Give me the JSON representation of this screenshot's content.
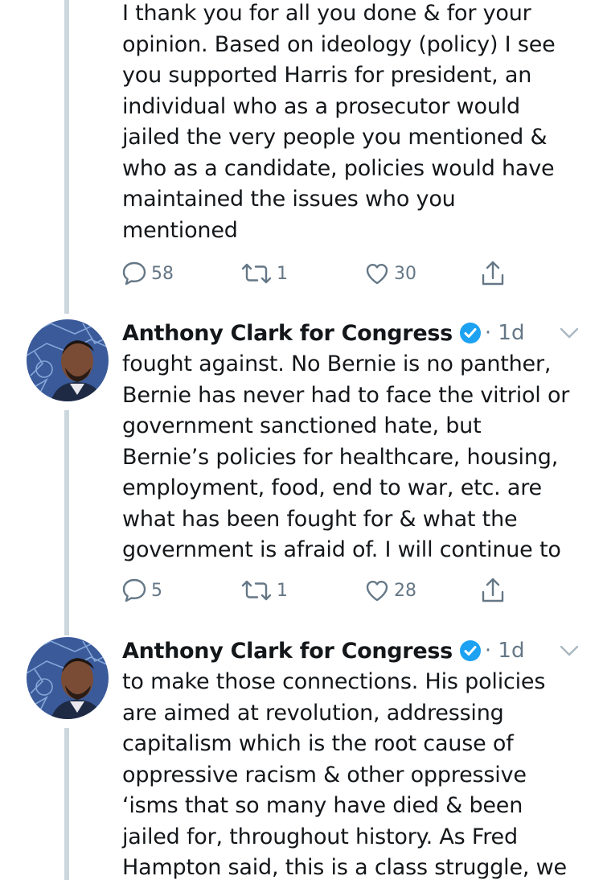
{
  "tweets": [
    {
      "text_lines": [
        "I thank you for all you done & for your",
        "opinion. Based on ideology (policy) I see",
        "you supported Harris for president, an",
        "individual who as a prosecutor would",
        "jailed the very people you mentioned &",
        "who as a candidate, policies would have",
        "maintained the issues who you",
        "mentioned"
      ],
      "replies": "58",
      "retweets": "1",
      "likes": "30"
    },
    {
      "author": "Anthony Clark for Congress",
      "time": "· 1d",
      "text_lines": [
        "fought against. No Bernie is no panther,",
        "Bernie has never had to face the vitriol or",
        "government sanctioned hate, but",
        "Bernie’s policies for healthcare, housing,",
        "employment, food, end to war, etc. are",
        "what has been fought for & what the",
        "government is afraid of. I will continue to"
      ],
      "replies": "5",
      "retweets": "1",
      "likes": "28"
    },
    {
      "author": "Anthony Clark for Congress",
      "time": "· 1d",
      "text_lines": [
        "to make those connections. His policies",
        "are aimed at revolution, addressing",
        "capitalism which is the root cause of",
        "oppressive racism & other oppressive",
        "‘isms that so many have died & been",
        "jailed for, throughout history. As Fred",
        "Hampton said, this is a class struggle, we"
      ]
    }
  ],
  "icons": {
    "reply": "reply-icon",
    "retweet": "retweet-icon",
    "like": "heart-icon",
    "share": "share-icon",
    "verified": "verified-badge-icon",
    "menu": "chevron-down-icon"
  },
  "colors": {
    "text": "#14171a",
    "secondary": "#657786",
    "thread_line": "#ccd6dd",
    "verified_blue": "#1da1f2"
  }
}
